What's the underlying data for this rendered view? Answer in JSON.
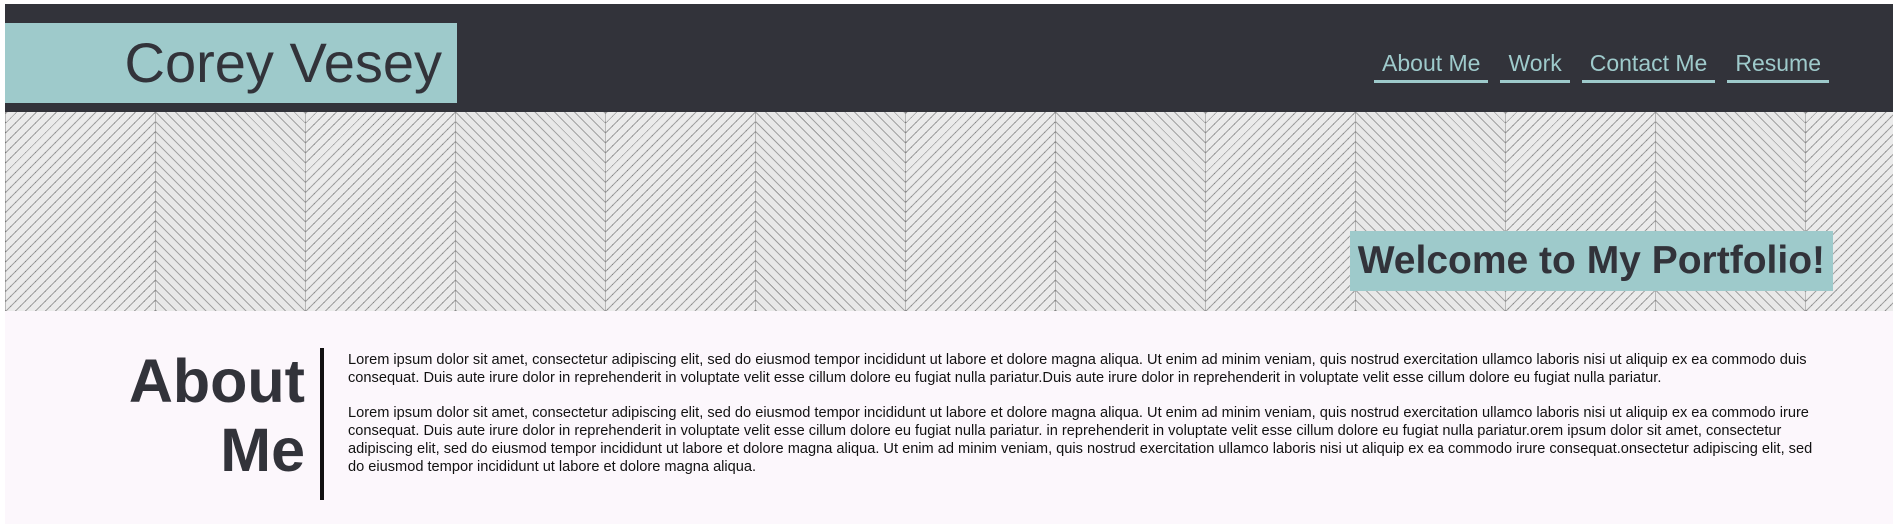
{
  "header": {
    "brand": "Corey Vesey",
    "nav": [
      {
        "label": "About Me"
      },
      {
        "label": "Work"
      },
      {
        "label": "Contact Me"
      },
      {
        "label": "Resume"
      }
    ]
  },
  "hero": {
    "welcome": "Welcome to My Portfolio!"
  },
  "about": {
    "title_line1": "About",
    "title_line2": "Me",
    "paragraphs": [
      "Lorem ipsum dolor sit amet, consectetur adipiscing elit, sed do eiusmod tempor incididunt ut labore et dolore magna aliqua. Ut enim ad minim veniam, quis nostrud exercitation ullamco laboris nisi ut aliquip ex ea commodo duis consequat. Duis aute irure dolor in reprehenderit in voluptate velit esse cillum dolore eu fugiat nulla pariatur.Duis aute irure dolor in reprehenderit in voluptate velit esse cillum dolore eu fugiat nulla pariatur.",
      "Lorem ipsum dolor sit amet, consectetur adipiscing elit, sed do eiusmod tempor incididunt ut labore et dolore magna aliqua. Ut enim ad minim veniam, quis nostrud exercitation ullamco laboris nisi ut aliquip ex ea commodo irure consequat. Duis aute irure dolor in reprehenderit in voluptate velit esse cillum dolore eu fugiat nulla pariatur. in reprehenderit in voluptate velit esse cillum dolore eu fugiat nulla pariatur.orem ipsum dolor sit amet, consectetur adipiscing elit, sed do eiusmod tempor incididunt ut labore et dolore magna aliqua. Ut enim ad minim veniam, quis nostrud exercitation ullamco laboris nisi ut aliquip ex ea commodo irure consequat.onsectetur adipiscing elit, sed do eiusmod tempor incididunt ut labore et dolore magna aliqua."
    ]
  },
  "colors": {
    "dark": "#32333a",
    "accent": "#9ecacb",
    "background": "#fcf7fc"
  }
}
